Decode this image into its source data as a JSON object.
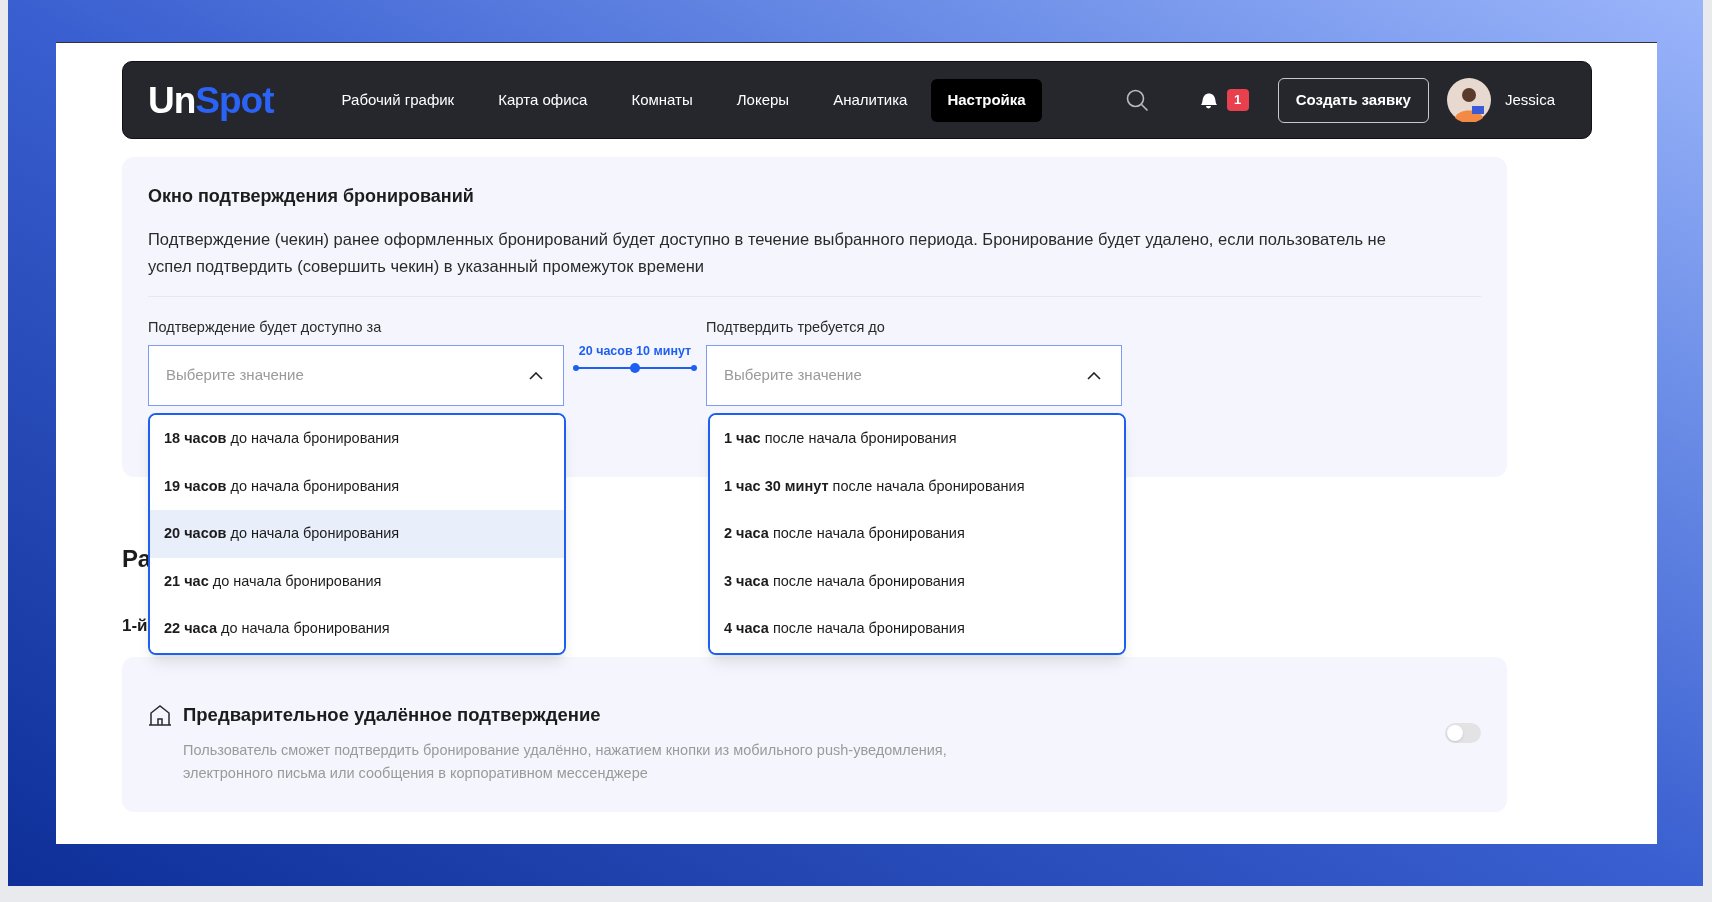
{
  "header": {
    "logo": [
      "Un",
      "Spot"
    ],
    "nav": [
      {
        "label": "Рабочий график",
        "selected": false
      },
      {
        "label": "Карта офиса",
        "selected": false
      },
      {
        "label": "Комнаты",
        "selected": false
      },
      {
        "label": "Локеры",
        "selected": false
      },
      {
        "label": "Аналитика",
        "selected": false
      },
      {
        "label": "Настройка",
        "selected": true
      }
    ],
    "notification_count": "1",
    "create_button": "Создать заявку",
    "user_name": "Jessica"
  },
  "confirmation_window": {
    "title": "Окно подтверждения бронирований",
    "description": "Подтверждение (чекин) ранее оформленных бронирований будет доступно в течение выбранного периода. Бронирование будет удалено, если пользователь не успел подтвердить (совершить чекин) в указанный промежуток времени",
    "start_select": {
      "label": "Подтверждение будет доступно за",
      "placeholder": "Выберите значение",
      "expanded": true,
      "options": [
        {
          "label": "**18 часов** до начала бронирования",
          "selected": false
        },
        {
          "label": "**19 часов** до начала бронирования",
          "selected": false
        },
        {
          "label": "**20 часов** до начала бронирования",
          "selected": true
        },
        {
          "label": "**21 час** до начала бронирования",
          "selected": false
        },
        {
          "label": "**22 часа** до начала бронирования",
          "selected": false
        }
      ]
    },
    "range": {
      "label": "20 часов 10 минут",
      "level": 0.5
    },
    "end_select": {
      "label": "Подтвердить требуется до",
      "placeholder": "Выберите значение",
      "expanded": true,
      "options": [
        {
          "label": "**1 час** после начала бронирования",
          "selected": false
        },
        {
          "label": "**1 час 30 минут** после начала бронирования",
          "selected": false
        },
        {
          "label": "**2 часа** после начала бронирования",
          "selected": false
        },
        {
          "label": "**3 часа** после начала бронирования",
          "selected": false
        },
        {
          "label": "**4 часа** после начала бронирования",
          "selected": false
        }
      ]
    }
  },
  "hidden_section": {
    "heading": "Ра",
    "subheading": "1-й"
  },
  "remote_confirmation": {
    "title": "Предварительное удалённое подтверждение",
    "description": "Пользователь сможет подтвердить бронирование удалённо, нажатием кнопки из мобильного push-уведомления, электронного письма или сообщения в корпоративном мессенджере",
    "on": false
  }
}
